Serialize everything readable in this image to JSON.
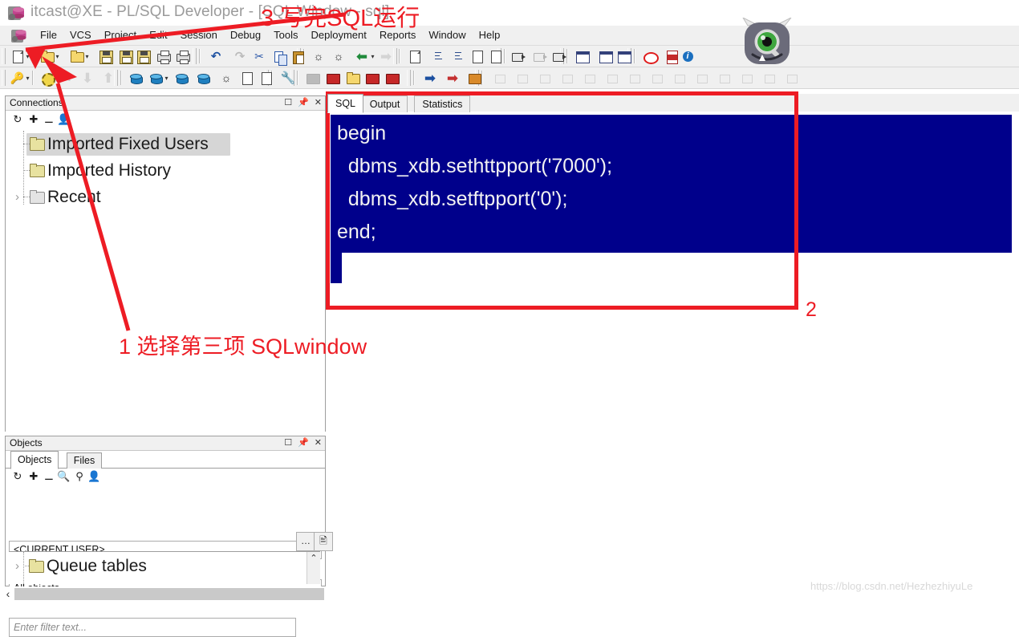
{
  "window": {
    "title": "itcast@XE - PL/SQL Developer - [SQL Window - sql]",
    "app_icon": "database-icon"
  },
  "menubar": {
    "items": [
      {
        "label": "File",
        "mnemonic": "F"
      },
      {
        "label": "VCS",
        "mnemonic": "V"
      },
      {
        "label": "Project",
        "mnemonic": "P"
      },
      {
        "label": "Edit",
        "mnemonic": "E"
      },
      {
        "label": "Session",
        "mnemonic": "S"
      },
      {
        "label": "Debug",
        "mnemonic": "D"
      },
      {
        "label": "Tools",
        "mnemonic": "T"
      },
      {
        "label": "Deployment",
        "mnemonic": ""
      },
      {
        "label": "Reports",
        "mnemonic": "R"
      },
      {
        "label": "Window",
        "mnemonic": "W"
      },
      {
        "label": "Help",
        "mnemonic": "H"
      }
    ]
  },
  "toolbar_row1": [
    {
      "name": "new-icon",
      "enabled": true
    },
    {
      "name": "open-folder-icon",
      "enabled": true
    },
    {
      "name": "open-recent-icon",
      "enabled": true
    },
    {
      "name": "save-icon",
      "enabled": true
    },
    {
      "name": "save-as-icon",
      "enabled": true
    },
    {
      "name": "save-all-icon",
      "enabled": true
    },
    {
      "name": "print-icon",
      "enabled": true
    },
    {
      "name": "print-preview-icon",
      "enabled": true
    },
    {
      "name": "undo-icon",
      "enabled": true
    },
    {
      "name": "redo-icon",
      "enabled": false
    },
    {
      "name": "cut-icon",
      "enabled": true
    },
    {
      "name": "copy-icon",
      "enabled": true
    },
    {
      "name": "paste-icon",
      "enabled": true
    },
    {
      "name": "find-icon",
      "enabled": true
    },
    {
      "name": "find-next-icon",
      "enabled": true
    },
    {
      "name": "export-icon",
      "enabled": true
    },
    {
      "name": "import-icon",
      "enabled": false
    },
    {
      "name": "check-syntax-icon",
      "enabled": true
    },
    {
      "name": "indent-icon",
      "enabled": true
    },
    {
      "name": "outdent-icon",
      "enabled": true
    },
    {
      "name": "comment-icon",
      "enabled": true
    },
    {
      "name": "uncomment-icon",
      "enabled": true
    },
    {
      "name": "run-debug-icon",
      "enabled": true
    },
    {
      "name": "step-icon",
      "enabled": false
    },
    {
      "name": "step-over-icon",
      "enabled": true
    },
    {
      "name": "window-list-icon",
      "enabled": true
    },
    {
      "name": "grid-view-icon",
      "enabled": true
    },
    {
      "name": "form-view-icon",
      "enabled": true
    },
    {
      "name": "stop-icon",
      "enabled": true
    },
    {
      "name": "pdf-export-icon",
      "enabled": true
    },
    {
      "name": "info-icon",
      "enabled": true
    }
  ],
  "toolbar_row2": [
    {
      "name": "key-icon",
      "enabled": true
    },
    {
      "name": "gear-icon",
      "enabled": true
    },
    {
      "name": "pencil-icon",
      "enabled": false
    },
    {
      "name": "download-icon",
      "enabled": false
    },
    {
      "name": "upload-icon",
      "enabled": false
    },
    {
      "name": "session-db-icon",
      "enabled": true
    },
    {
      "name": "sql-db-icon",
      "enabled": true
    },
    {
      "name": "connect-db-icon",
      "enabled": true
    },
    {
      "name": "disconnect-db-icon",
      "enabled": true
    },
    {
      "name": "compare-icon",
      "enabled": true
    },
    {
      "name": "checklist-icon",
      "enabled": true
    },
    {
      "name": "history-icon",
      "enabled": true
    },
    {
      "name": "wrench-icon",
      "enabled": true
    },
    {
      "name": "book-white-icon",
      "enabled": false
    },
    {
      "name": "book-red-icon",
      "enabled": true
    },
    {
      "name": "book-folder-icon",
      "enabled": true
    },
    {
      "name": "book-copy-icon",
      "enabled": true
    },
    {
      "name": "book-edit-icon",
      "enabled": true
    },
    {
      "name": "blue-arrow-icon",
      "enabled": true
    },
    {
      "name": "red-arrow-icon",
      "enabled": true
    },
    {
      "name": "toolbox-icon",
      "enabled": true
    }
  ],
  "connections_panel": {
    "title": "Connections",
    "window_buttons": [
      "maximize-icon",
      "pin-icon",
      "close-icon"
    ],
    "toolbar": [
      "refresh-icon",
      "add-icon",
      "remove-icon",
      "edit-user-icon"
    ],
    "tree": [
      {
        "label": "Imported Fixed Users",
        "icon": "folder-icon",
        "selected": true,
        "expandable": false
      },
      {
        "label": "Imported History",
        "icon": "folder-icon",
        "selected": false,
        "expandable": false
      },
      {
        "label": "Recent",
        "icon": "folder-grey-icon",
        "selected": false,
        "expandable": true,
        "chevron": "›"
      }
    ]
  },
  "objects_panel": {
    "title": "Objects",
    "window_buttons": [
      "maximize-icon",
      "pin-icon",
      "close-icon"
    ],
    "tabs": [
      {
        "label": "Objects",
        "active": true
      },
      {
        "label": "Files",
        "active": false
      }
    ],
    "toolbar": [
      "refresh-icon",
      "add-icon",
      "remove-icon",
      "find-icon",
      "filter-icon",
      "user-icon"
    ],
    "user_select": {
      "value": "<CURRENT USER>",
      "chevron": "⌄"
    },
    "type_select": {
      "value": "All objects",
      "chevron": "⌄"
    },
    "filter_input": {
      "placeholder": "Enter filter text...",
      "value": ""
    },
    "filter_buttons": [
      "ellipsis-button",
      "script-button"
    ],
    "tree": [
      {
        "label": "Queue tables",
        "icon": "folder-icon",
        "expandable": true,
        "chevron": "›"
      }
    ],
    "scroll_up_glyph": "⌃"
  },
  "sql_window": {
    "tabs": [
      {
        "label": "SQL",
        "active": true
      },
      {
        "label": "Output",
        "active": false
      },
      {
        "label": "Statistics",
        "active": false
      }
    ],
    "code": "begin\n  dbms_xdb.sethttpport('7000');\n  dbms_xdb.setftpport('0');\nend;",
    "editor_bg": "#00008b",
    "editor_fg": "#f2f2f2"
  },
  "annotations": {
    "accent_color": "#ed1c24",
    "items": [
      {
        "id": "ann-1",
        "text": "1 选择第三项 SQLwindow"
      },
      {
        "id": "ann-2",
        "text": "2"
      },
      {
        "id": "ann-3",
        "text": "3 写完SQL运行"
      }
    ]
  },
  "bottom_scrollbar": {
    "left_arrow_glyph": "‹"
  },
  "watermark": {
    "text": "https://blog.csdn.net/HezhezhiyuLe"
  }
}
